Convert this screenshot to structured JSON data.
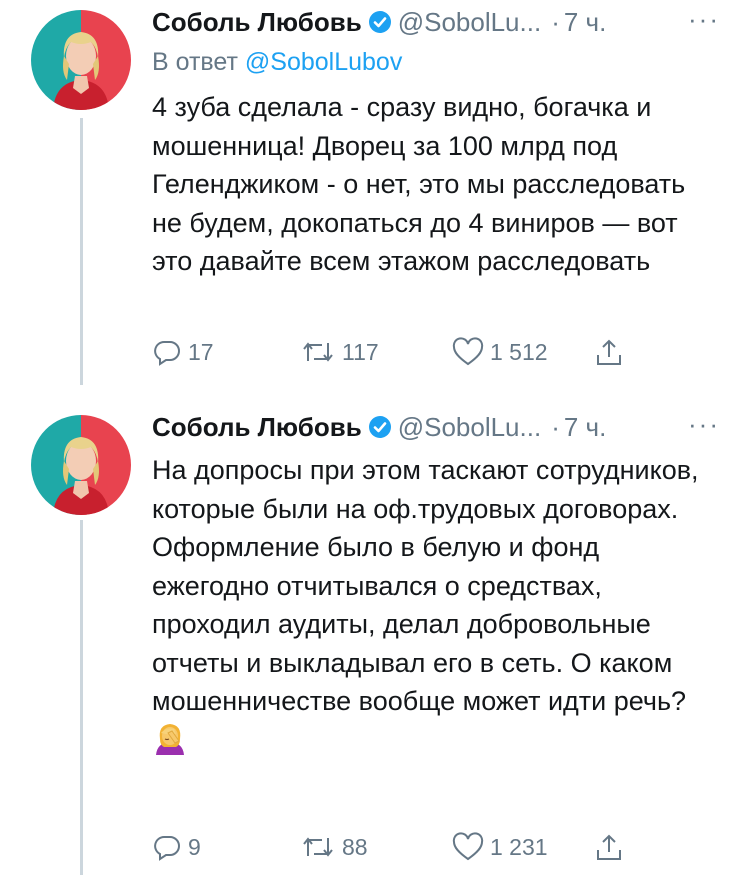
{
  "tweets": [
    {
      "author": "Соболь Любовь",
      "handle": "@SobolLu...",
      "time": "7 ч.",
      "reply_to_prefix": "В ответ",
      "reply_to_handle": "@SobolLubov",
      "text": "4 зуба сделала - сразу видно, богачка и мошенница! Дворец за 100 млрд под Геленджиком - о нет, это мы расследовать не будем, докопаться до 4 виниров — вот это давайте всем этажом расследовать",
      "replies": "17",
      "retweets": "117",
      "likes": "1 512"
    },
    {
      "author": "Соболь Любовь",
      "handle": "@SobolLu...",
      "time": "7 ч.",
      "text": "На допросы при этом таскают сотрудников, которые были на оф.трудовых договорах. Оформление было в белую и фонд ежегодно отчитывался о средствах, проходил аудиты, делал добровольные отчеты и выкладывал его в сеть. О каком мошенничестве вообще может идти речь?",
      "emoji": "woman-facepalming",
      "replies": "9",
      "retweets": "88",
      "likes": "1 231"
    }
  ],
  "ui": {
    "separator_dot": "·",
    "more": "···"
  },
  "colors": {
    "accent": "#1da1f2",
    "muted": "#657786",
    "thread_line": "#ccd6dd",
    "avatar_bg_left": "#1fa9a7",
    "avatar_bg_right": "#e8434f"
  }
}
